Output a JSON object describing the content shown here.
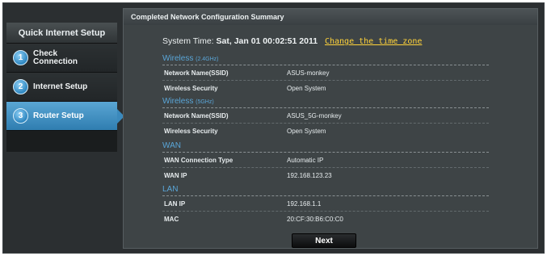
{
  "sidebar": {
    "title": "Quick Internet Setup",
    "steps": [
      {
        "num": "1",
        "label_line1": "Check",
        "label_line2": "Connection"
      },
      {
        "num": "2",
        "label_line1": "Internet Setup",
        "label_line2": ""
      },
      {
        "num": "3",
        "label_line1": "Router Setup",
        "label_line2": ""
      }
    ],
    "active_step": 3
  },
  "main": {
    "header": "Completed Network Configuration Summary",
    "system_time_label": "System Time:",
    "system_time_value": "Sat, Jan 01 00:02:51 2011",
    "change_timezone_link": "Change the time zone",
    "sections": [
      {
        "title": "Wireless",
        "title_sub": "(2.4GHz)",
        "rows": [
          {
            "key": "Network Name(SSID)",
            "value": "ASUS-monkey"
          },
          {
            "key": "Wireless Security",
            "value": "Open System"
          }
        ]
      },
      {
        "title": "Wireless",
        "title_sub": "(5GHz)",
        "rows": [
          {
            "key": "Network Name(SSID)",
            "value": "ASUS_5G-monkey"
          },
          {
            "key": "Wireless Security",
            "value": "Open System"
          }
        ]
      },
      {
        "title": "WAN",
        "title_sub": "",
        "rows": [
          {
            "key": "WAN Connection Type",
            "value": "Automatic IP"
          },
          {
            "key": "WAN IP",
            "value": "192.168.123.23"
          }
        ]
      },
      {
        "title": "LAN",
        "title_sub": "",
        "rows": [
          {
            "key": "LAN IP",
            "value": "192.168.1.1"
          },
          {
            "key": "MAC",
            "value": "20:CF:30:B6:C0:C0"
          }
        ]
      }
    ],
    "next_label": "Next"
  },
  "colors": {
    "accent_blue": "#5aa6d8",
    "link_yellow": "#ffd33a",
    "panel_bg": "#3e4446",
    "active_step_bg": "#3b89bc"
  }
}
